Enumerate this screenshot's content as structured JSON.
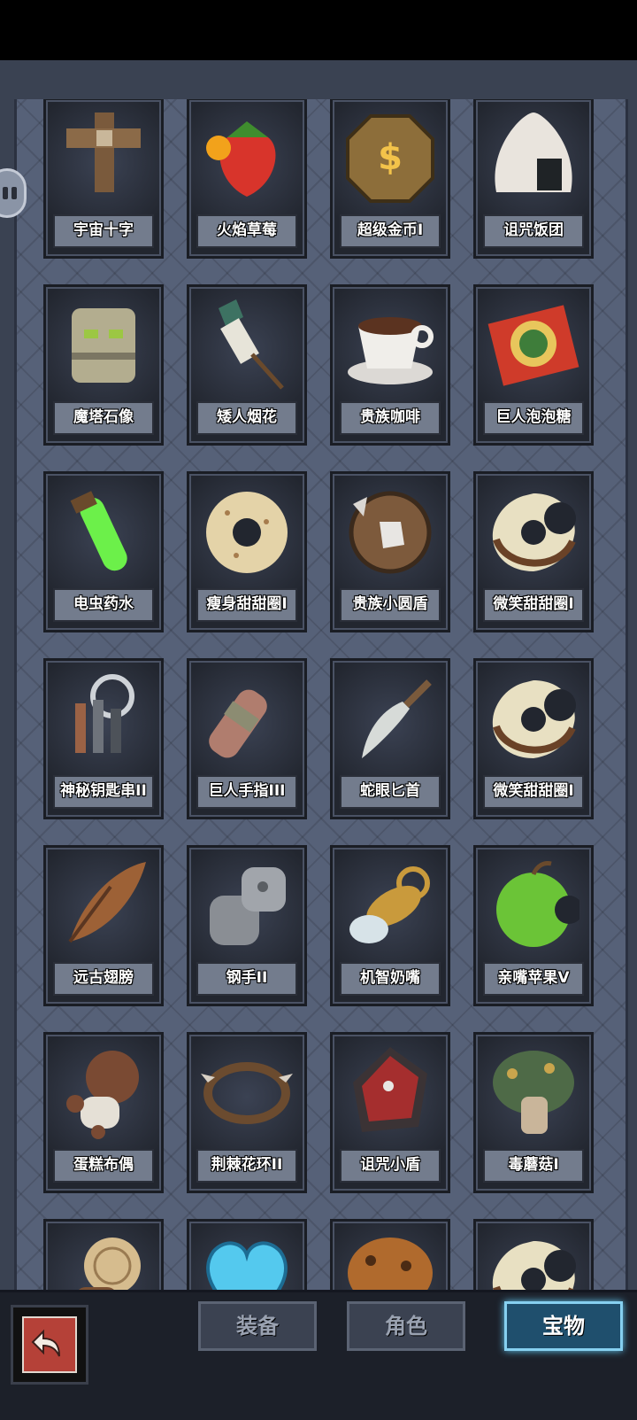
{
  "inventory": {
    "items": [
      {
        "name": "宇宙十字",
        "icon": "wooden-cross-icon"
      },
      {
        "name": "火焰草莓",
        "icon": "fire-strawberry-icon"
      },
      {
        "name": "超级金币I",
        "icon": "gold-coin-icon"
      },
      {
        "name": "诅咒饭团",
        "icon": "rice-ball-icon"
      },
      {
        "name": "魔塔石像",
        "icon": "stone-totem-icon"
      },
      {
        "name": "矮人烟花",
        "icon": "firework-rocket-icon"
      },
      {
        "name": "贵族咖啡",
        "icon": "coffee-cup-icon"
      },
      {
        "name": "巨人泡泡糖",
        "icon": "bubble-gum-pack-icon"
      },
      {
        "name": "电虫药水",
        "icon": "green-potion-icon"
      },
      {
        "name": "瘦身甜甜圈I",
        "icon": "donut-icon"
      },
      {
        "name": "贵族小圆盾",
        "icon": "round-shield-icon"
      },
      {
        "name": "微笑甜甜圈I",
        "icon": "bitten-donut-icon"
      },
      {
        "name": "神秘钥匙串II",
        "icon": "key-ring-icon"
      },
      {
        "name": "巨人手指III",
        "icon": "giant-finger-icon"
      },
      {
        "name": "蛇眼匕首",
        "icon": "dagger-icon"
      },
      {
        "name": "微笑甜甜圈I",
        "icon": "bitten-donut-icon"
      },
      {
        "name": "远古翅膀",
        "icon": "wing-icon"
      },
      {
        "name": "钢手II",
        "icon": "steel-gauntlet-icon"
      },
      {
        "name": "机智奶嘴",
        "icon": "pacifier-icon"
      },
      {
        "name": "亲嘴苹果V",
        "icon": "green-apple-icon"
      },
      {
        "name": "蛋糕布偶",
        "icon": "voodoo-doll-icon"
      },
      {
        "name": "荆棘花环II",
        "icon": "thorn-wreath-icon"
      },
      {
        "name": "诅咒小盾",
        "icon": "cursed-shield-icon"
      },
      {
        "name": "毒蘑菇I",
        "icon": "poison-mushroom-icon"
      },
      {
        "name": "",
        "icon": "wood-doll-icon"
      },
      {
        "name": "",
        "icon": "blue-crystal-heart-icon"
      },
      {
        "name": "",
        "icon": "brown-mushroom-icon"
      },
      {
        "name": "",
        "icon": "bitten-donut-icon"
      }
    ]
  },
  "footer": {
    "back_icon": "return-arrow-icon",
    "tabs": [
      {
        "label": "装备",
        "active": false
      },
      {
        "label": "角色",
        "active": false
      },
      {
        "label": "宝物",
        "active": true
      }
    ]
  },
  "colors": {
    "panel": "#3a4252",
    "frame": "#566178",
    "card": "#22262f",
    "active_tab": "#1f4f6d",
    "back_button": "#b54138"
  }
}
